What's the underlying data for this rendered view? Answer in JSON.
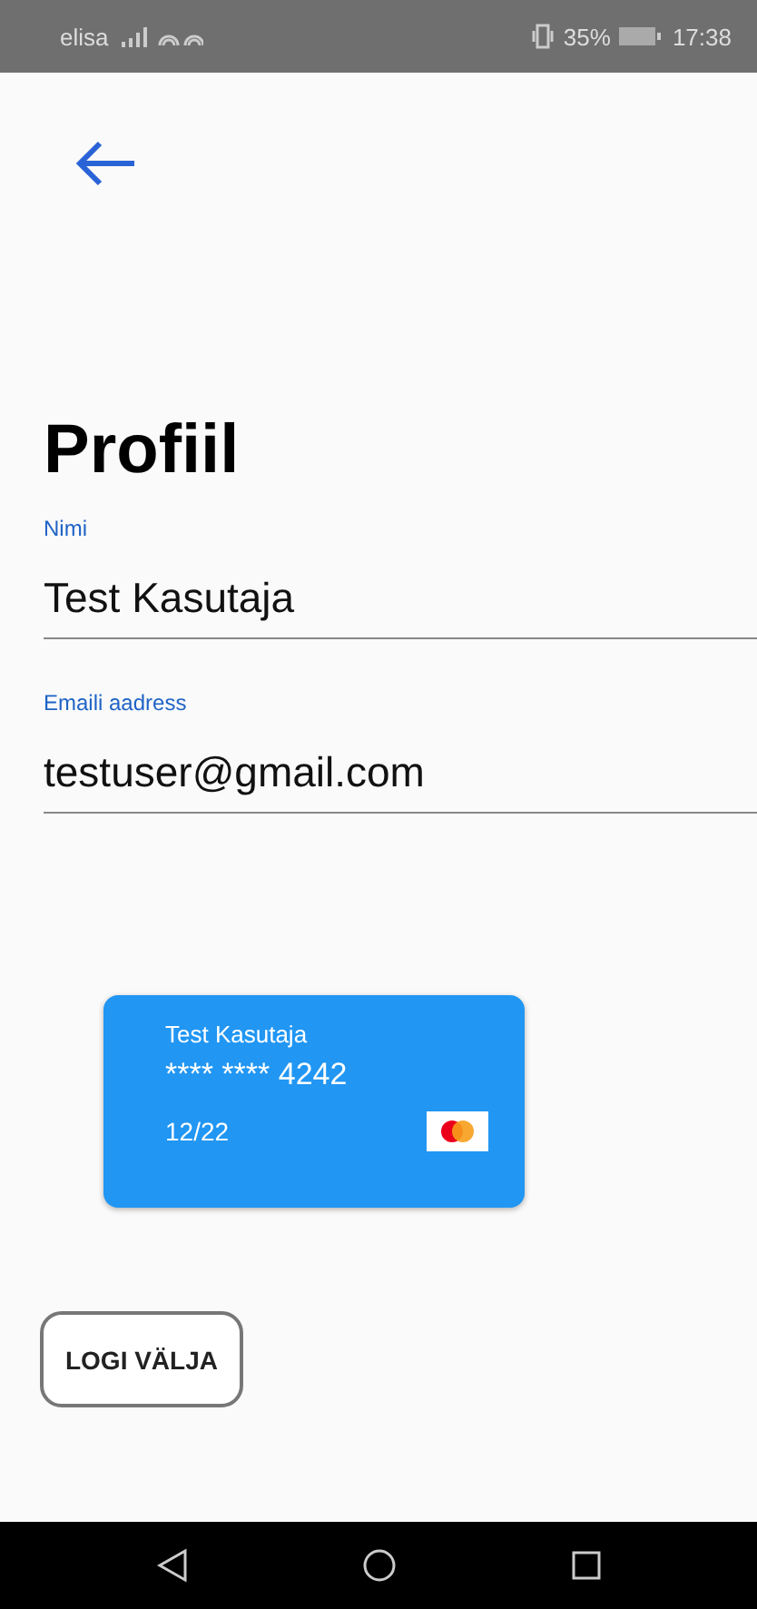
{
  "status_bar": {
    "carrier": "elisa",
    "battery": "35%",
    "time": "17:38"
  },
  "title": "Profiil",
  "fields": [
    {
      "label": "Nimi",
      "value": "Test Kasutaja"
    },
    {
      "label": "Emaili aadress",
      "value": "testuser@gmail.com"
    }
  ],
  "card": {
    "holder": "Test Kasutaja",
    "number": "**** **** 4242",
    "expiry": "12/22"
  },
  "logout_button": "LOGI VÄLJA"
}
